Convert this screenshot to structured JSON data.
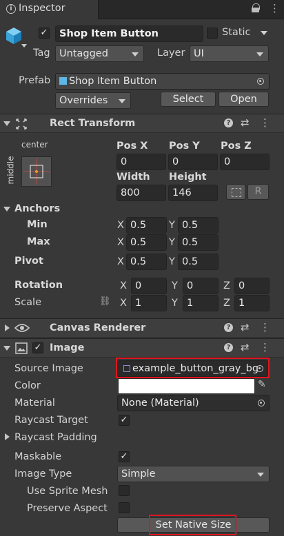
{
  "tab": {
    "title": "Inspector"
  },
  "header": {
    "object_name": "Shop Item Button",
    "static_label": "Static",
    "tag_label": "Tag",
    "tag_value": "Untagged",
    "layer_label": "Layer",
    "layer_value": "UI",
    "prefab_label": "Prefab",
    "prefab_value": "Shop Item Button",
    "overrides_label": "Overrides",
    "select_label": "Select",
    "open_label": "Open"
  },
  "rect_transform": {
    "title": "Rect Transform",
    "anchor_h": "center",
    "anchor_v": "middle",
    "pos_x_label": "Pos X",
    "pos_y_label": "Pos Y",
    "pos_z_label": "Pos Z",
    "pos_x": "0",
    "pos_y": "0",
    "pos_z": "0",
    "width_label": "Width",
    "height_label": "Height",
    "width": "800",
    "height": "146",
    "raw_label": "R",
    "anchors_label": "Anchors",
    "min_label": "Min",
    "max_label": "Max",
    "pivot_label": "Pivot",
    "x_label": "X",
    "y_label": "Y",
    "z_label": "Z",
    "min_x": "0.5",
    "min_y": "0.5",
    "max_x": "0.5",
    "max_y": "0.5",
    "pivot_x": "0.5",
    "pivot_y": "0.5",
    "rotation_label": "Rotation",
    "scale_label": "Scale",
    "rot_x": "0",
    "rot_y": "0",
    "rot_z": "0",
    "scale_x": "1",
    "scale_y": "1",
    "scale_z": "1"
  },
  "canvas_renderer": {
    "title": "Canvas Renderer"
  },
  "image": {
    "title": "Image",
    "source_image_label": "Source Image",
    "source_image_value": "example_button_gray_bg",
    "color_label": "Color",
    "color_value": "#ffffff",
    "material_label": "Material",
    "material_value": "None (Material)",
    "raycast_target_label": "Raycast Target",
    "raycast_padding_label": "Raycast Padding",
    "maskable_label": "Maskable",
    "image_type_label": "Image Type",
    "image_type_value": "Simple",
    "use_sprite_mesh_label": "Use Sprite Mesh",
    "preserve_aspect_label": "Preserve Aspect",
    "set_native_size_label": "Set Native Size",
    "check_glyph": "✓"
  }
}
